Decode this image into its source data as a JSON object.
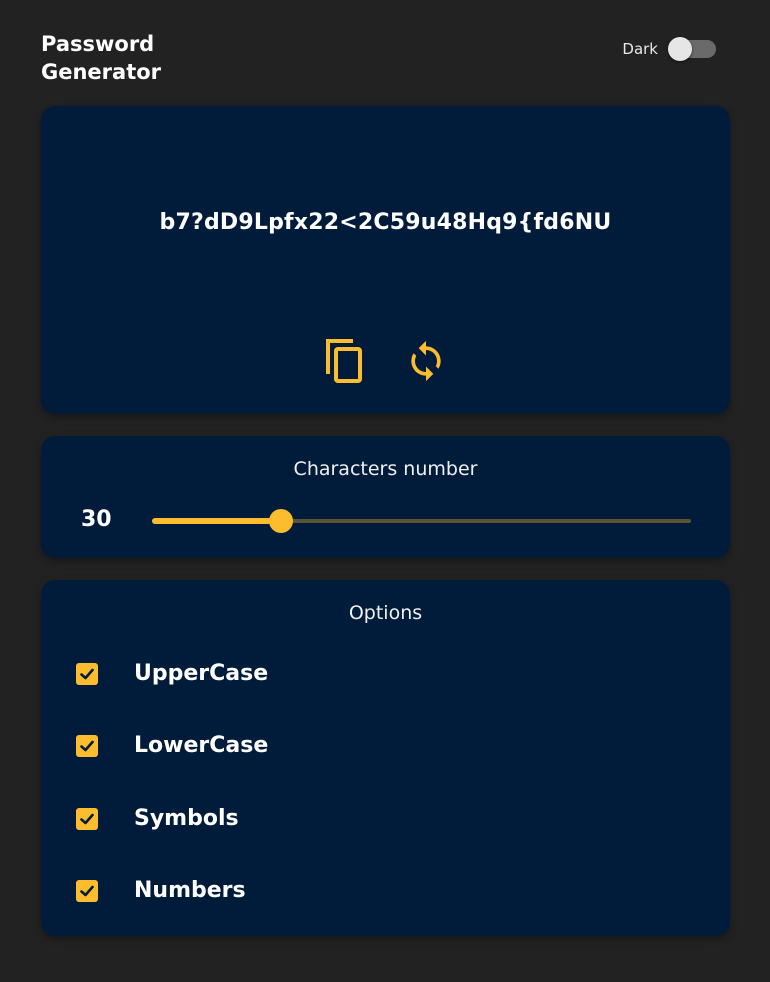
{
  "header": {
    "title": "Password\nGenerator",
    "theme_label": "Dark",
    "theme_on": false
  },
  "password": {
    "value": "b7?dD9Lpfx22<2C59u48Hq9{fd6NU",
    "copy_icon": "copy-icon",
    "refresh_icon": "refresh-icon"
  },
  "length": {
    "heading": "Characters number",
    "value": "30",
    "slider_fraction": 0.24
  },
  "options": {
    "heading": "Options",
    "items": [
      {
        "label": "UpperCase",
        "checked": true
      },
      {
        "label": "LowerCase",
        "checked": true
      },
      {
        "label": "Symbols",
        "checked": true
      },
      {
        "label": "Numbers",
        "checked": true
      }
    ]
  },
  "colors": {
    "background": "#222222",
    "card": "#001c3a",
    "accent": "#fbbd2e"
  }
}
